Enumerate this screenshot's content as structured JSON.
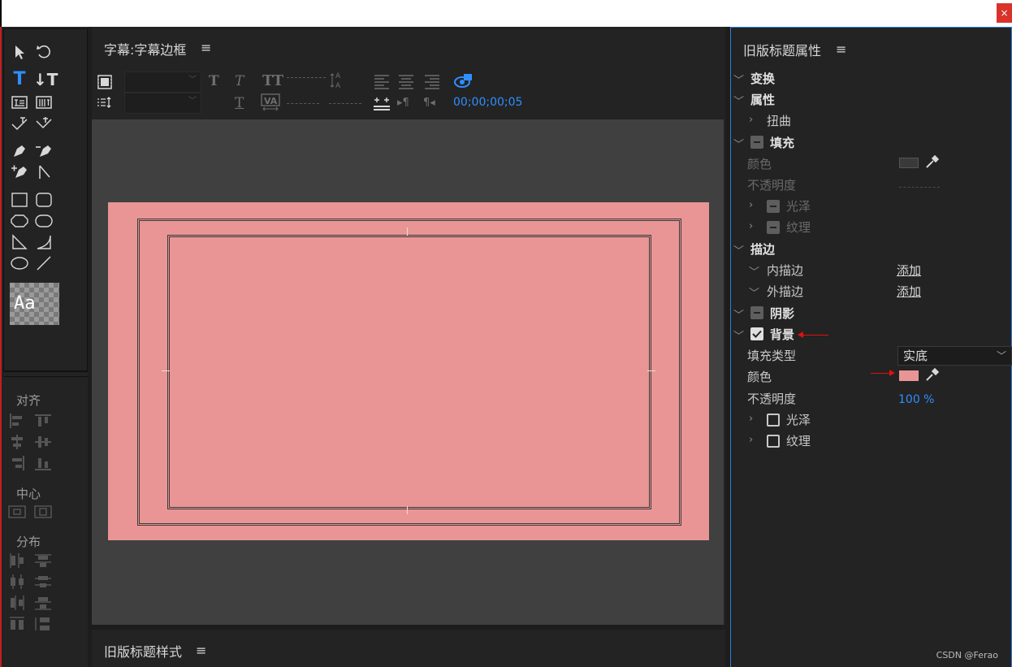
{
  "window": {
    "close_label": "×"
  },
  "editor": {
    "title": "字幕:字幕边框",
    "menu_icon": "≡",
    "timecode": "00;00;00;05",
    "background_color": "#e99595"
  },
  "tools": {
    "style_sample_text": "Aa"
  },
  "align_panel": {
    "align_label": "对齐",
    "center_label": "中心",
    "distribute_label": "分布"
  },
  "bottom_panel": {
    "title": "旧版标题样式",
    "menu_icon": "≡"
  },
  "properties": {
    "title": "旧版标题属性",
    "menu_icon": "≡",
    "transform": "变换",
    "attributes": "属性",
    "distort": "扭曲",
    "fill": "填充",
    "fill_color_label": "颜色",
    "fill_opacity_label": "不透明度",
    "fill_sheen": "光泽",
    "fill_texture": "纹理",
    "strokes": "描边",
    "inner_stroke": "内描边",
    "outer_stroke": "外描边",
    "add_link": "添加",
    "shadow": "阴影",
    "background": "背景",
    "fill_type_label": "填充类型",
    "fill_type_value": "实底",
    "bg_color_label": "颜色",
    "bg_color": "#e99595",
    "bg_opacity_label": "不透明度",
    "bg_opacity_value": "100 %",
    "bg_sheen": "光泽",
    "bg_texture": "纹理"
  },
  "watermark": "CSDN @Ferao"
}
